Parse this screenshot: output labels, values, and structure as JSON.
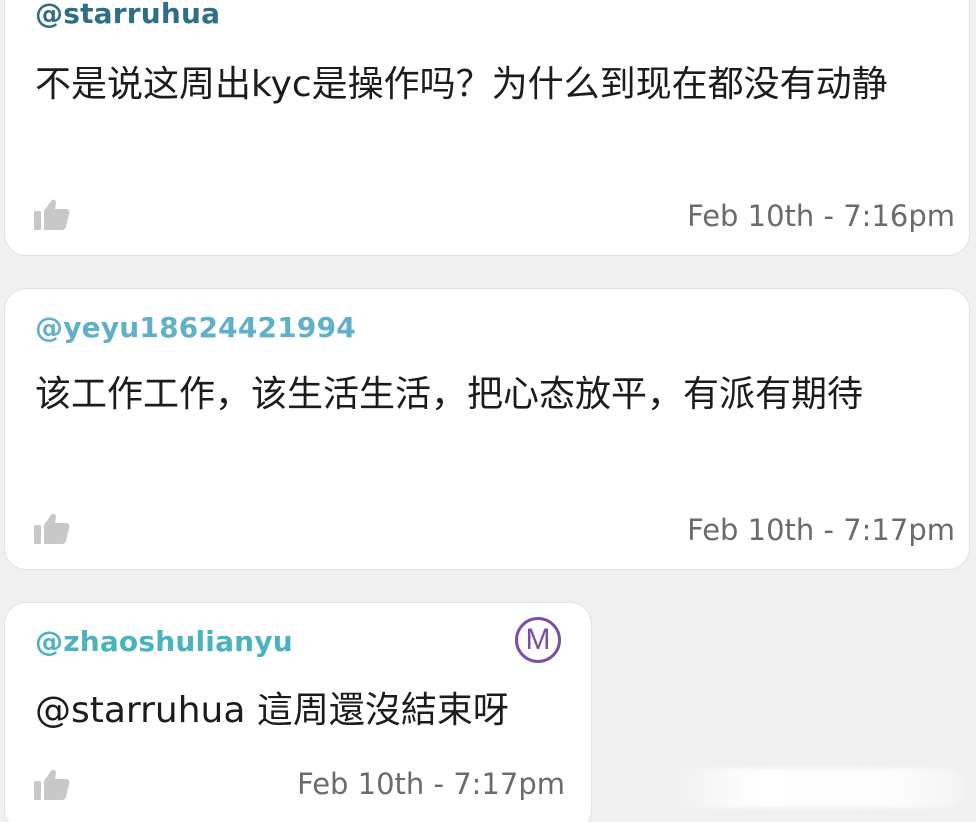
{
  "comments": [
    {
      "username": "@starruhua",
      "username_color": "#2e6f86",
      "body": "不是说这周出kyc是操作吗？为什么到现在都没有动静",
      "timestamp": "Feb 10th - 7:16pm",
      "like_icon": "thumbs-up-icon"
    },
    {
      "username": "@yeyu18624421994",
      "username_color": "#5fb0c8",
      "body": "该工作工作，该生活生活，把心态放平，有派有期待",
      "timestamp": "Feb 10th - 7:17pm",
      "like_icon": "thumbs-up-icon"
    },
    {
      "username": "@zhaoshulianyu",
      "username_color": "#4ab3c0",
      "badge": "M",
      "badge_color": "#7b4fa8",
      "body": "@starruhua 這周還沒結束呀",
      "timestamp": "Feb 10th - 7:17pm",
      "like_icon": "thumbs-up-icon"
    }
  ]
}
